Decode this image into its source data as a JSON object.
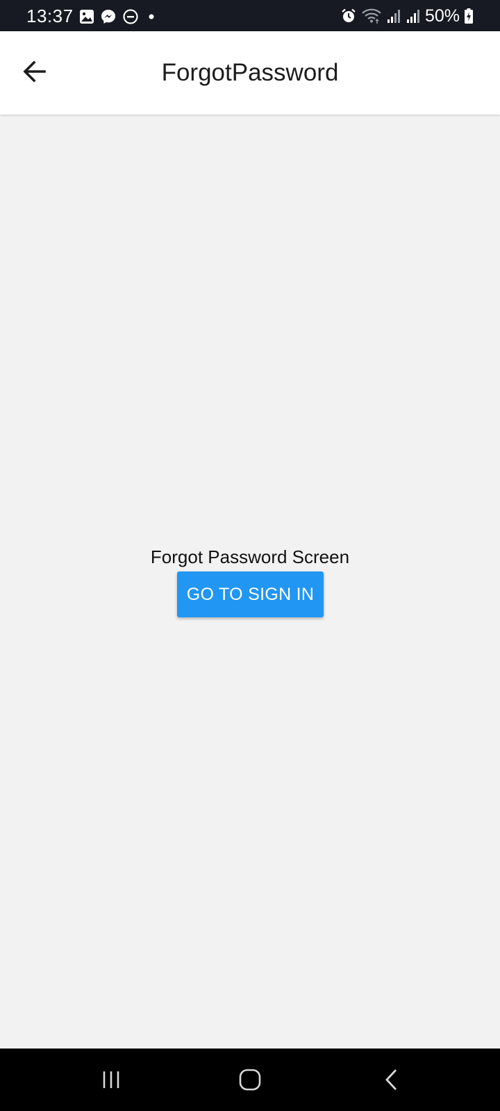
{
  "status_bar": {
    "time": "13:37",
    "battery_percent": "50%",
    "left_icons": [
      "gallery-icon",
      "messenger-icon",
      "do-not-disturb-icon",
      "dot-icon"
    ],
    "right_icons": [
      "alarm-icon",
      "wifi-icon",
      "signal-icon",
      "signal-icon",
      "battery-charging-icon"
    ],
    "background_color": "#171a22"
  },
  "app_bar": {
    "title": "ForgotPassword",
    "back_icon": "arrow-left-icon"
  },
  "main": {
    "screen_label": "Forgot Password Screen",
    "sign_in_button_label": "GO TO SIGN IN",
    "button_color": "#2196f3"
  },
  "nav_bar": {
    "buttons": [
      "recent-apps-icon",
      "home-icon",
      "back-icon"
    ]
  }
}
